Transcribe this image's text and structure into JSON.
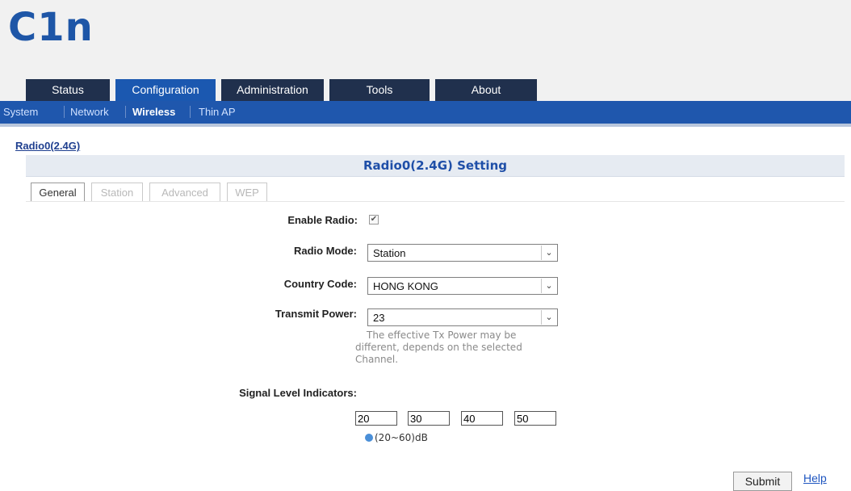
{
  "logo": "C1n",
  "main_tabs": [
    "Status",
    "Configuration",
    "Administration",
    "Tools",
    "About"
  ],
  "sub_nav": [
    "System",
    "Network",
    "Wireless",
    "Thin AP"
  ],
  "section_link": "Radio0(2.4G)",
  "setting_title": "Radio0(2.4G) Setting",
  "sub_tabs": [
    "General",
    "Station",
    "Advanced",
    "WEP"
  ],
  "form": {
    "enable_radio_label": "Enable Radio:",
    "enable_radio_checked": true,
    "radio_mode_label": "Radio Mode:",
    "radio_mode_value": "Station",
    "country_code_label": "Country Code:",
    "country_code_value": "HONG KONG",
    "transmit_power_label": "Transmit Power:",
    "transmit_power_value": "23",
    "tx_note": "The effective Tx Power may be different, depends on the selected Channel.",
    "signal_label": "Signal Level Indicators:",
    "signal_values": [
      "20",
      "30",
      "40",
      "50"
    ],
    "signal_range": "(20~60)dB"
  },
  "submit_label": "Submit",
  "help_label": "Help",
  "colors": {
    "brand_blue": "#1e56a7",
    "nav_dark": "#20304d",
    "nav_active": "#1b58b0",
    "subbar": "#1f57ad"
  },
  "icons": [
    "checkbox-check-icon",
    "dropdown-arrow-icon",
    "info-icon"
  ]
}
